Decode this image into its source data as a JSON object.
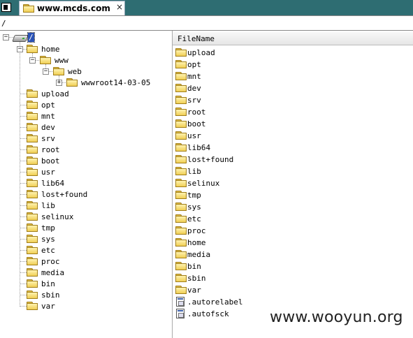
{
  "tab": {
    "title": "www.mcds.com",
    "close": "×",
    "icon": "folder-icon"
  },
  "path": {
    "value": "/"
  },
  "tree": {
    "root": "/",
    "home": "home",
    "www": "www",
    "web": "web",
    "wwwroot": "wwwroot14-03-05",
    "siblings": [
      "upload",
      "opt",
      "mnt",
      "dev",
      "srv",
      "root",
      "boot",
      "usr",
      "lib64",
      "lost+found",
      "lib",
      "selinux",
      "tmp",
      "sys",
      "etc",
      "proc",
      "media",
      "bin",
      "sbin",
      "var"
    ]
  },
  "list": {
    "header": "FileName",
    "folders": [
      "upload",
      "opt",
      "mnt",
      "dev",
      "srv",
      "root",
      "boot",
      "usr",
      "lib64",
      "lost+found",
      "lib",
      "selinux",
      "tmp",
      "sys",
      "etc",
      "proc",
      "home",
      "media",
      "bin",
      "sbin",
      "var"
    ],
    "files": [
      ".autorelabel",
      ".autofsck"
    ]
  },
  "watermark": "www.wooyun.org"
}
